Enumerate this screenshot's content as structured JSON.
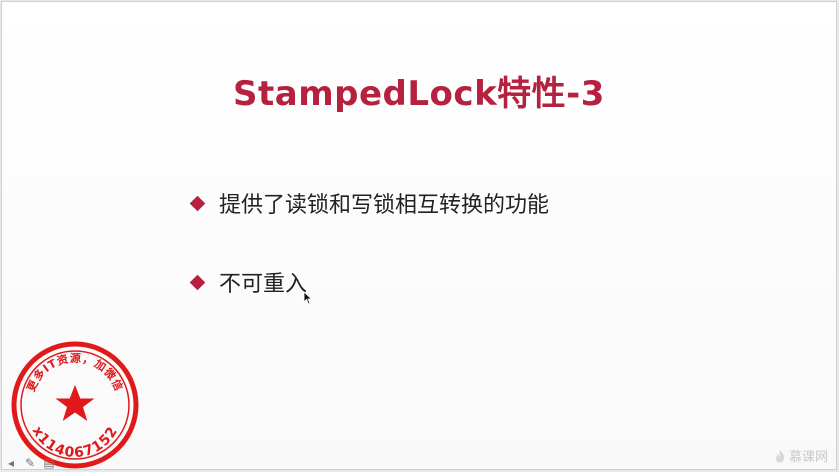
{
  "slide": {
    "title": "StampedLock特性-3",
    "bullets": [
      "提供了读锁和写锁相互转换的功能",
      "不可重入"
    ]
  },
  "stamp": {
    "arc_text": "更多IT资源，加微信",
    "id_text": "x114067152",
    "color": "#e0191b"
  },
  "watermark": {
    "label": "慕课网",
    "icon": "flame-icon"
  },
  "controls": {
    "prev_icon": "arrow-left-icon",
    "pen_icon": "pen-icon",
    "slides_icon": "slides-icon"
  },
  "colors": {
    "accent": "#b5213e",
    "text": "#222222",
    "background": "#ffffff"
  }
}
